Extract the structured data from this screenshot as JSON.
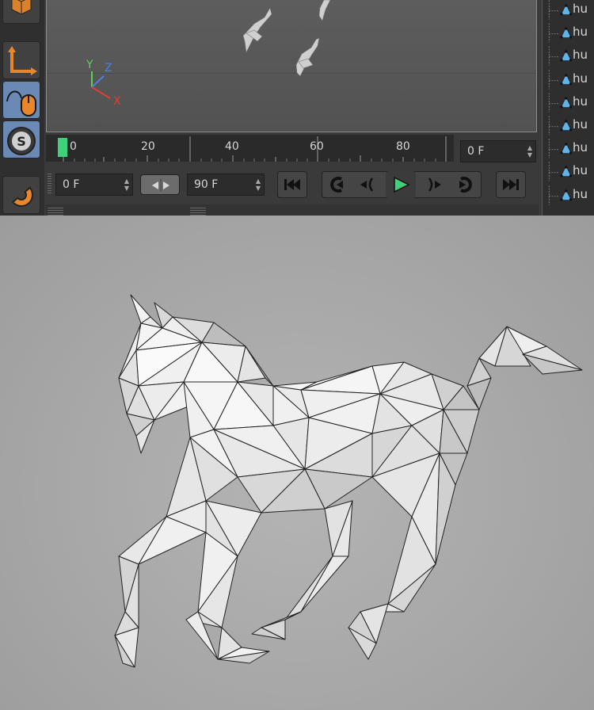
{
  "timeline": {
    "ticks": [
      "0",
      "20",
      "40",
      "60",
      "80"
    ],
    "end_field": "0 F"
  },
  "transport": {
    "start_field": "0 F",
    "end_field": "90 F"
  },
  "object_panel": {
    "items": [
      "hu",
      "hu",
      "hu",
      "hu",
      "hu",
      "hu",
      "hu",
      "hu",
      "hu"
    ]
  },
  "viewport": {
    "axis_x": "X",
    "axis_y": "Y",
    "axis_z": "Z"
  },
  "colors": {
    "accent": "#6a8ab5",
    "play": "#3fd17a",
    "axis_x": "#e0412e",
    "axis_y": "#5ad35a",
    "axis_z": "#4f7fe0"
  }
}
